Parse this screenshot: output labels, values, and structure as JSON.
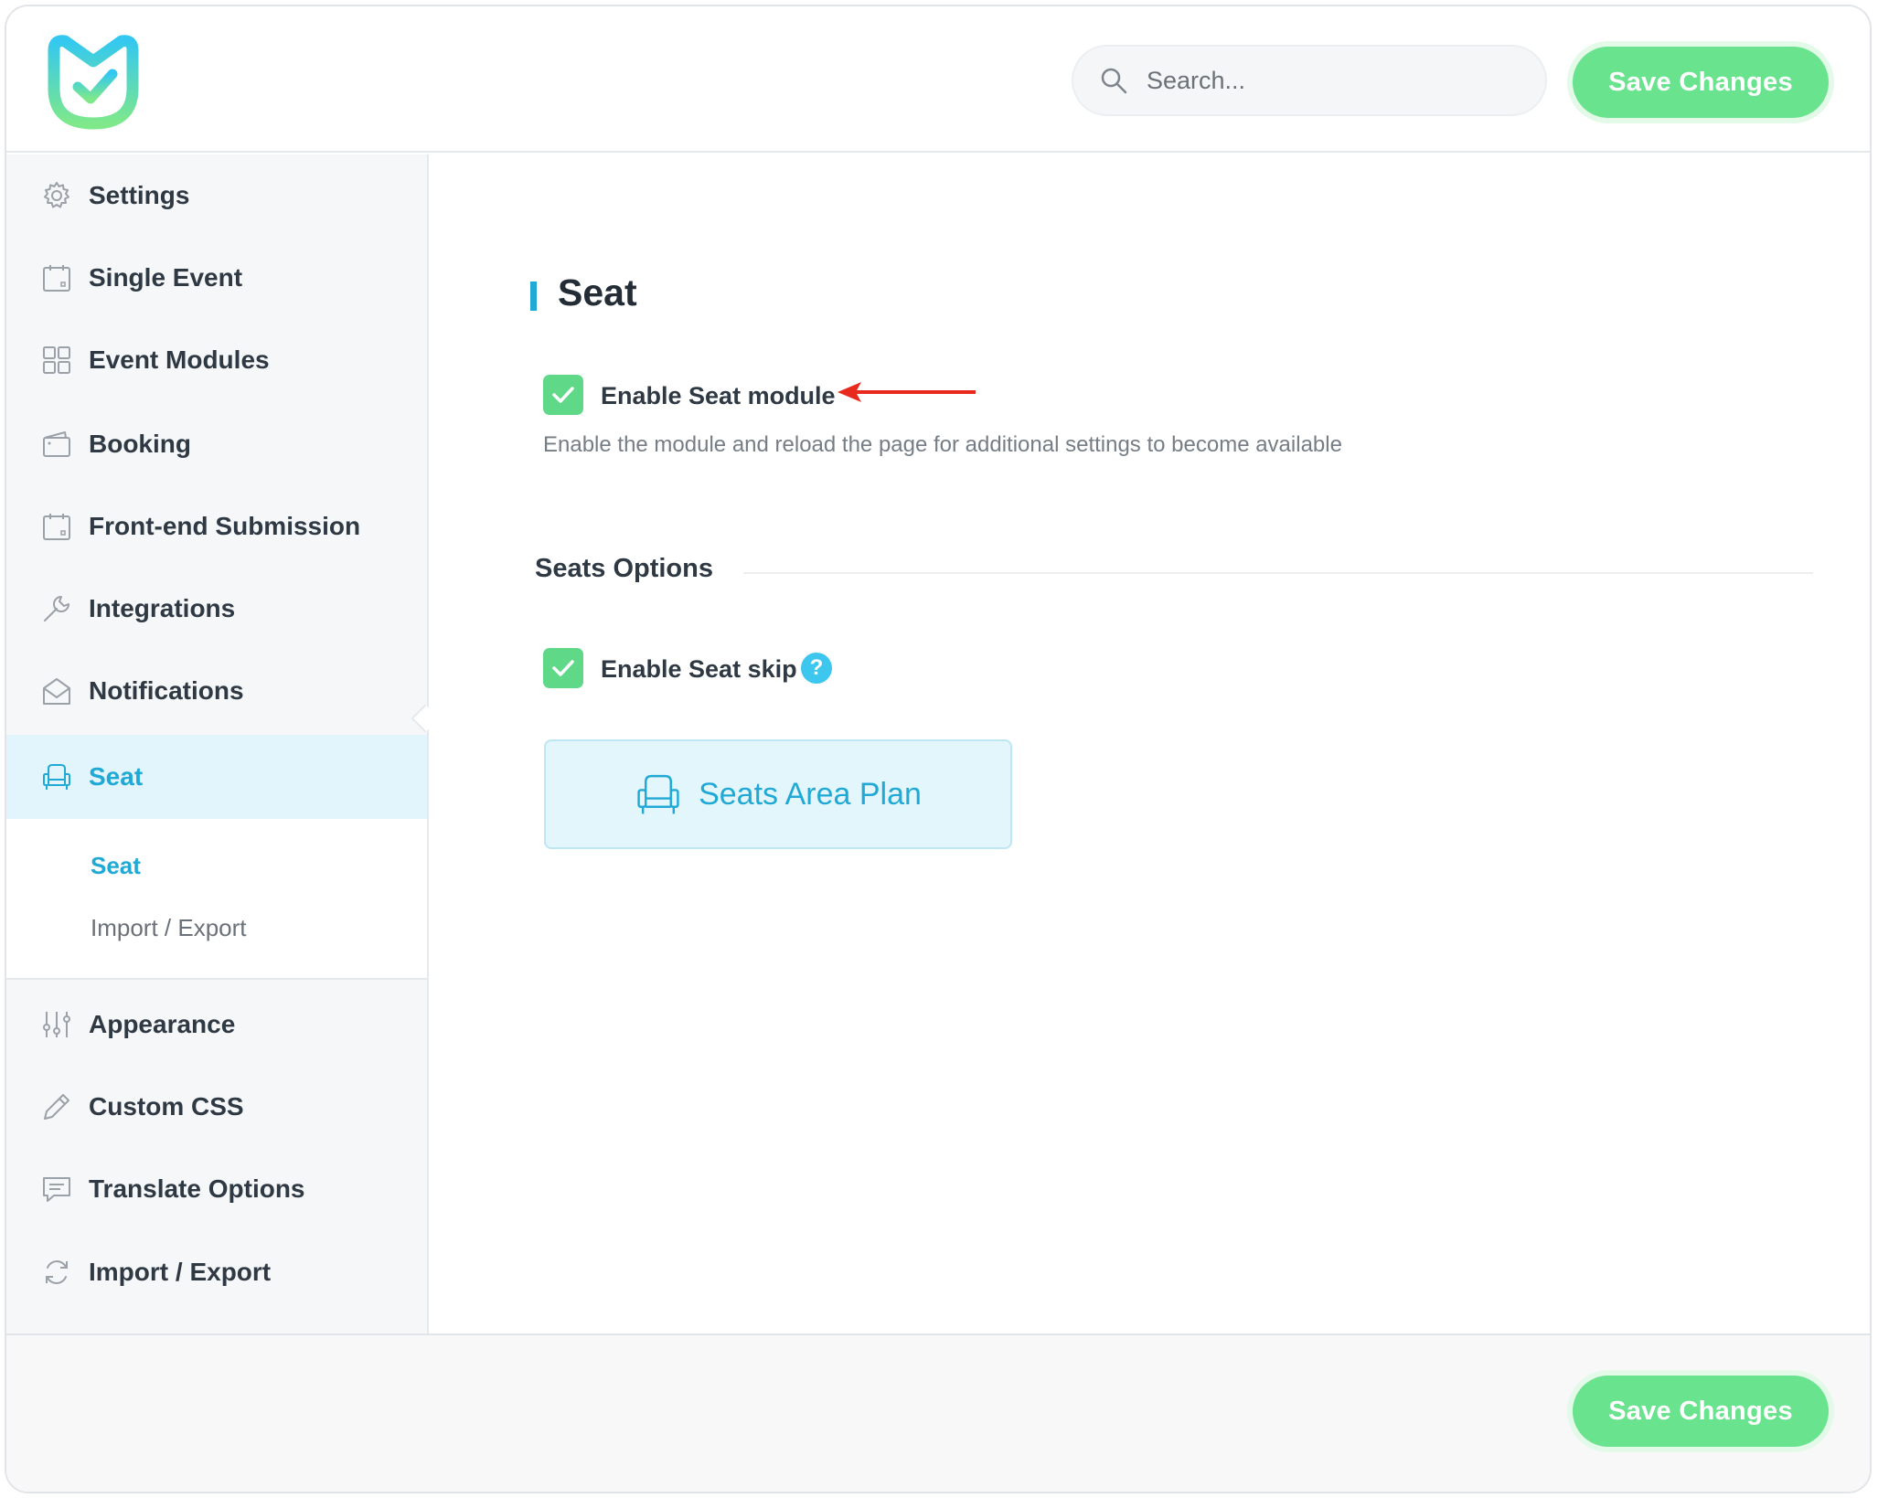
{
  "header": {
    "search_placeholder": "Search...",
    "save_label": "Save Changes"
  },
  "sidebar": {
    "items": [
      {
        "label": "Settings",
        "icon": "gear-icon"
      },
      {
        "label": "Single Event",
        "icon": "calendar-icon"
      },
      {
        "label": "Event Modules",
        "icon": "grid-icon"
      },
      {
        "label": "Booking",
        "icon": "wallet-icon"
      },
      {
        "label": "Front-end Submission",
        "icon": "calendar-icon"
      },
      {
        "label": "Integrations",
        "icon": "wrench-icon"
      },
      {
        "label": "Notifications",
        "icon": "envelope-icon"
      },
      {
        "label": "Seat",
        "icon": "armchair-icon",
        "active": true
      },
      {
        "label": "Appearance",
        "icon": "sliders-icon"
      },
      {
        "label": "Custom CSS",
        "icon": "pencil-icon"
      },
      {
        "label": "Translate Options",
        "icon": "chat-icon"
      },
      {
        "label": "Import / Export",
        "icon": "refresh-icon"
      }
    ],
    "subitems": [
      {
        "label": "Seat",
        "active": true
      },
      {
        "label": "Import / Export",
        "active": false
      }
    ]
  },
  "main": {
    "title": "Seat",
    "enable_module": {
      "label": "Enable Seat module",
      "checked": true
    },
    "hint": "Enable the module and reload the page for additional settings to become available",
    "section_title": "Seats Options",
    "enable_skip": {
      "label": "Enable Seat skip",
      "checked": true
    },
    "help_glyph": "?",
    "plan_button": "Seats Area Plan"
  },
  "footer": {
    "save_label": "Save Changes"
  },
  "colors": {
    "accent": "#21a9d6",
    "save_green": "#6ae38f",
    "check_green": "#5fd888",
    "arrow_red": "#e8291d"
  }
}
